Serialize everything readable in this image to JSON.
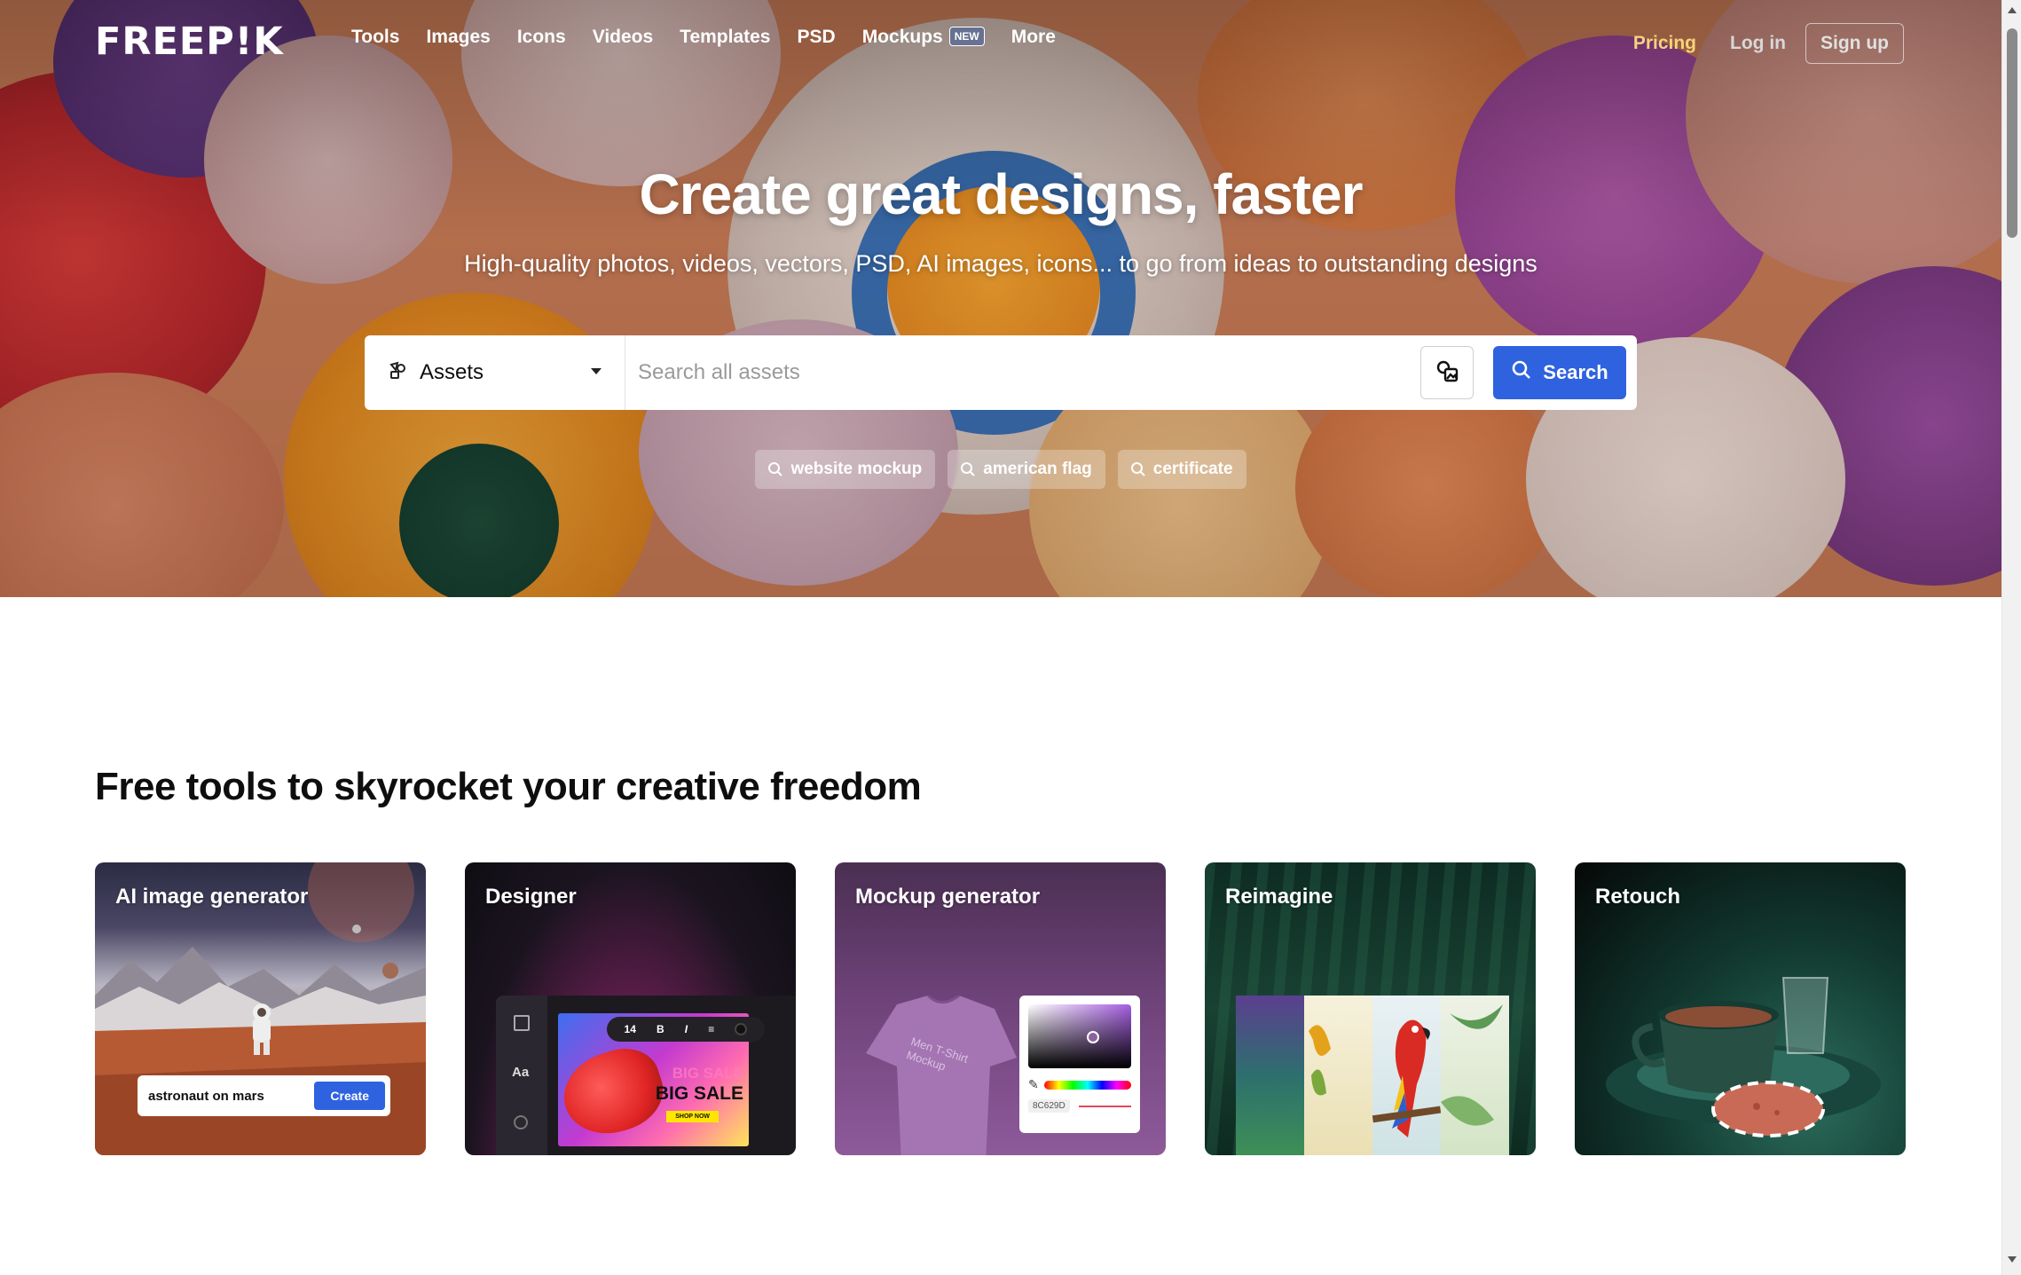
{
  "nav": {
    "logo": "FREEP!K",
    "links": [
      "Tools",
      "Images",
      "Icons",
      "Videos",
      "Templates",
      "PSD",
      "Mockups",
      "More"
    ],
    "mockups_badge": "NEW",
    "pricing": "Pricing",
    "login": "Log in",
    "signup": "Sign up"
  },
  "hero": {
    "title": "Create great designs, faster",
    "subtitle": "High-quality photos, videos, vectors, PSD, AI images, icons... to go from ideas to outstanding designs"
  },
  "search": {
    "category": "Assets",
    "placeholder": "Search all assets",
    "button": "Search",
    "suggestions": [
      "website mockup",
      "american flag",
      "certificate"
    ]
  },
  "tools": {
    "heading": "Free tools to skyrocket your creative freedom",
    "cards": [
      {
        "title": "AI image generator",
        "prompt": "astronaut on mars",
        "button": "Create"
      },
      {
        "title": "Designer",
        "font_size": "14",
        "banner_line1": "BIG SALE",
        "banner_line2": "BIG SALE",
        "banner_cta": "SHOP NOW"
      },
      {
        "title": "Mockup generator",
        "shirt_text": "Men T-Shirt Mockup",
        "hex": "8C629D"
      },
      {
        "title": "Reimagine"
      },
      {
        "title": "Retouch"
      }
    ]
  },
  "colors": {
    "accent": "#2f62df",
    "pricing": "#f6d27a"
  }
}
